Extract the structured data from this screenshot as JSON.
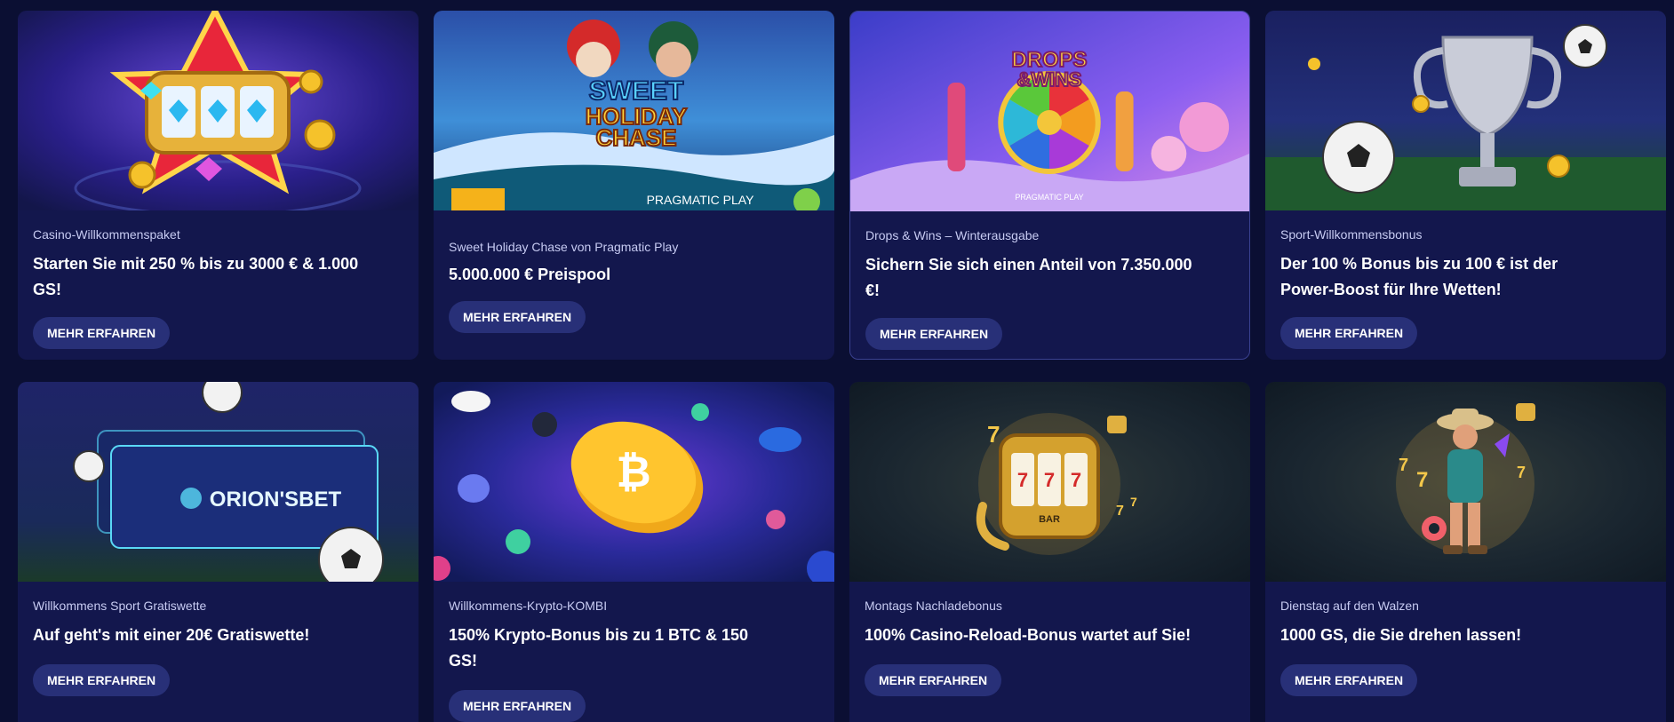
{
  "colors": {
    "page_bg": "#0b0f33",
    "card_bg": "#13174d",
    "button_bg": "#283078",
    "tag_text": "#c7cbf2"
  },
  "cards": [
    {
      "tag": "Casino-Willkommenspaket",
      "title": "Starten Sie mit 250 % bis zu 3000 € & 1.000 GS!",
      "button": "MEHR ERFAHREN",
      "image": "slot-machine-star-illustration"
    },
    {
      "tag": "Sweet Holiday Chase von Pragmatic Play",
      "title": "5.000.000 € Preispool",
      "button": "MEHR ERFAHREN",
      "image": "sweet-holiday-chase-banner",
      "image_text": [
        "SWEET",
        "HOLIDAY",
        "CHASE",
        "PRAGMATIC PLAY"
      ]
    },
    {
      "tag": "Drops & Wins – Winterausgabe",
      "title": "Sichern Sie sich einen Anteil von 7.350.000 €!",
      "button": "MEHR ERFAHREN",
      "image": "drops-and-wins-banner",
      "image_text": [
        "DROPS",
        "&WINS",
        "PRAGMATIC PLAY"
      ]
    },
    {
      "tag": "Sport-Willkommensbonus",
      "title": "Der 100 % Bonus bis zu 100 € ist der Power-Boost für Ihre Wetten!",
      "button": "MEHR ERFAHREN",
      "image": "trophy-soccer-balls-banner"
    },
    {
      "tag": "Willkommens Sport Gratiswette",
      "title": "Auf geht's mit einer 20€ Gratiswette!",
      "button": "MEHR ERFAHREN",
      "image": "orionsbet-ticket-banner",
      "image_text": [
        "ORION'SBET"
      ]
    },
    {
      "tag": "Willkommens-Krypto-KOMBI",
      "title": "150% Krypto-Bonus bis zu 1 BTC & 150 GS!",
      "button": "MEHR ERFAHREN",
      "image": "bitcoin-coin-banner"
    },
    {
      "tag": "Montags Nachladebonus",
      "title": "100% Casino-Reload-Bonus wartet auf Sie!",
      "button": "MEHR ERFAHREN",
      "image": "golden-slot-machine-banner",
      "image_text": [
        "7",
        "7",
        "7",
        "BAR"
      ]
    },
    {
      "tag": "Dienstag auf den Walzen",
      "title": "1000 GS, die Sie drehen lassen!",
      "button": "MEHR ERFAHREN",
      "image": "cowboy-character-banner"
    }
  ]
}
